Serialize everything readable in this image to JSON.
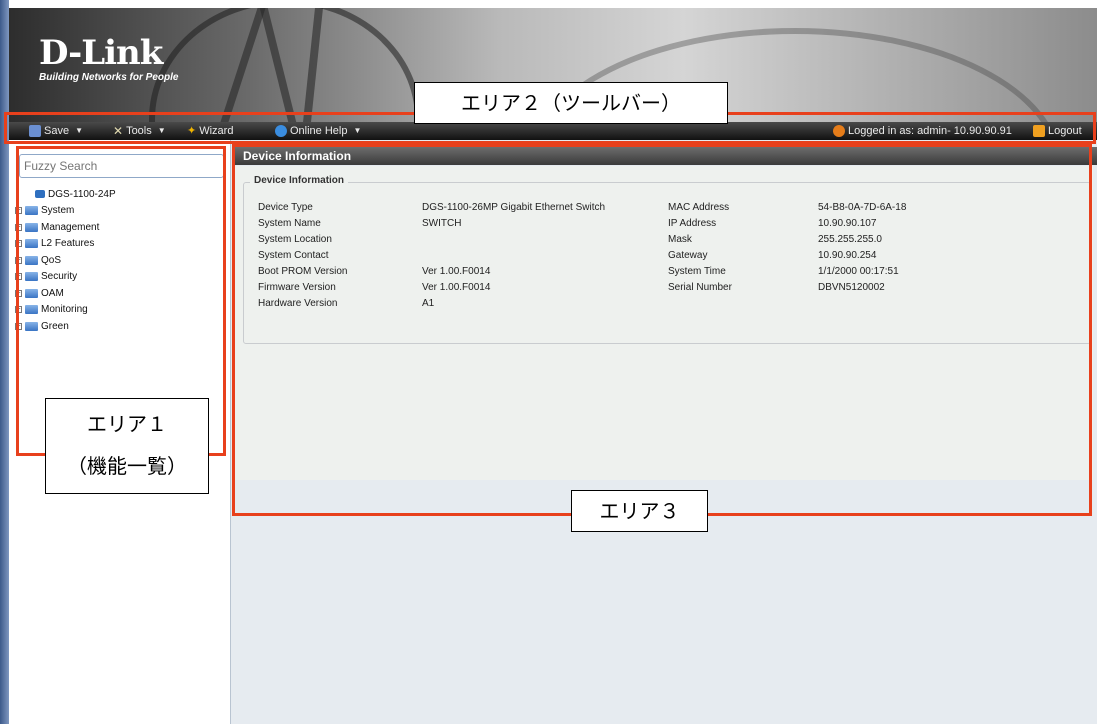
{
  "banner": {
    "brand": "D-Link",
    "tagline": "Building Networks for People"
  },
  "toolbar": {
    "save": "Save",
    "tools": "Tools",
    "wizard": "Wizard",
    "help": "Online Help",
    "logged_in": "Logged in as: admin- 10.90.90.91",
    "logout": "Logout"
  },
  "sidebar": {
    "search_placeholder": "Fuzzy Search",
    "root": "DGS-1100-24P",
    "items": [
      "System",
      "Management",
      "L2 Features",
      "QoS",
      "Security",
      "OAM",
      "Monitoring",
      "Green"
    ]
  },
  "content": {
    "title": "Device Information",
    "section": "Device Information",
    "left_fields": [
      {
        "label": "Device Type",
        "value": "DGS-1100-26MP   Gigabit Ethernet Switch"
      },
      {
        "label": "System Name",
        "value": "SWITCH"
      },
      {
        "label": "System Location",
        "value": ""
      },
      {
        "label": "System Contact",
        "value": ""
      },
      {
        "label": "Boot PROM Version",
        "value": "Ver 1.00.F0014"
      },
      {
        "label": "Firmware Version",
        "value": "Ver 1.00.F0014"
      },
      {
        "label": "Hardware Version",
        "value": "A1"
      }
    ],
    "right_fields": [
      {
        "label": "MAC Address",
        "value": "54-B8-0A-7D-6A-18"
      },
      {
        "label": "IP Address",
        "value": "10.90.90.107"
      },
      {
        "label": "Mask",
        "value": "255.255.255.0"
      },
      {
        "label": "Gateway",
        "value": "10.90.90.254"
      },
      {
        "label": "System Time",
        "value": "1/1/2000 00:17:51"
      },
      {
        "label": "Serial Number",
        "value": "DBVN5120002"
      }
    ]
  },
  "annotations": {
    "area1_line1": "エリア１",
    "area1_line2": "（機能一覧）",
    "area2": "エリア２（ツールバー）",
    "area3": "エリア３",
    "color": "#e8401c"
  }
}
